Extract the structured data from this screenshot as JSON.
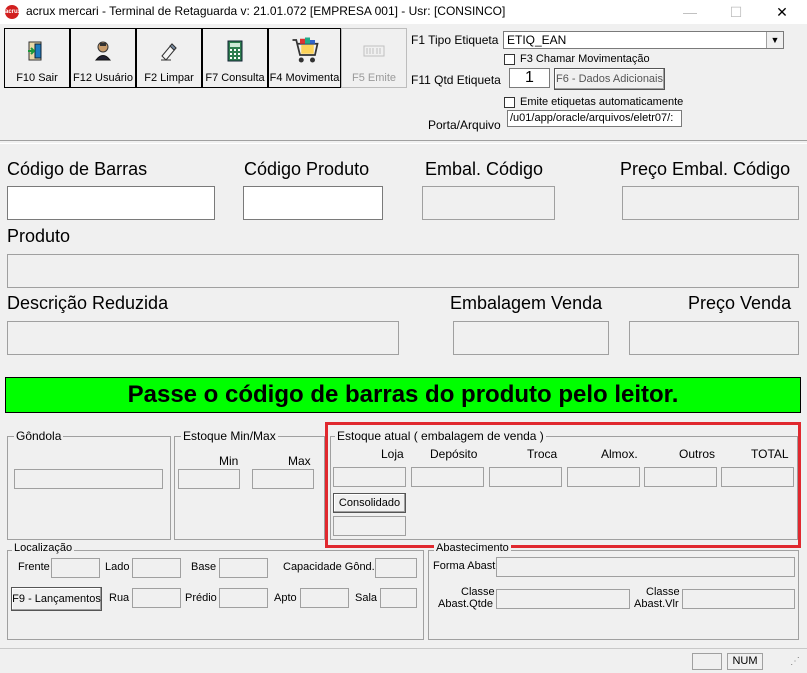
{
  "window": {
    "title": "acrux mercari - Terminal de Retaguarda v: 21.01.072 [EMPRESA 001] - Usr: [CONSINCO]",
    "icon_text": "acrux",
    "minimize": "—",
    "maximize": "☐",
    "close": "✕"
  },
  "toolbar": [
    {
      "label": "F10 Sair",
      "icon": "exit-door-icon",
      "enabled": true
    },
    {
      "label": "F12 Usuário",
      "icon": "user-icon",
      "enabled": true
    },
    {
      "label": "F2 Limpar",
      "icon": "eraser-icon",
      "enabled": true
    },
    {
      "label": "F7 Consulta",
      "icon": "calculator-icon",
      "enabled": true
    },
    {
      "label": "F4 Movimenta",
      "icon": "shopping-cart-icon",
      "enabled": true
    },
    {
      "label": "F5 Emite",
      "icon": "barcode-label-icon",
      "enabled": false
    }
  ],
  "settings": {
    "tipo_etiqueta_label": "F1 Tipo Etiqueta",
    "tipo_etiqueta_value": "ETIQ_EAN",
    "chamar_mov_label": "F3 Chamar Movimentação",
    "qtd_etiqueta_label": "F11 Qtd Etiqueta",
    "qtd_etiqueta_value": "1",
    "dados_adicionais_label": "F6 - Dados Adicionais",
    "emite_auto_label": "Emite etiquetas automaticamente",
    "porta_label": "Porta/Arquivo",
    "porta_value": "/u01/app/oracle/arquivos/eletr07/:"
  },
  "product": {
    "codigo_barras_label": "Código de Barras",
    "codigo_barras_value": "",
    "codigo_produto_label": "Código Produto",
    "codigo_produto_value": "",
    "embal_codigo_label": "Embal. Código",
    "preco_embal_codigo_label": "Preço Embal. Código",
    "produto_label": "Produto",
    "descricao_reduzida_label": "Descrição Reduzida",
    "embalagem_venda_label": "Embalagem Venda",
    "preco_venda_label": "Preço Venda"
  },
  "banner": {
    "message": "Passe o código de barras do produto pelo leitor.",
    "color": "#00ff00"
  },
  "gondola": {
    "title": "Gôndola"
  },
  "estoque_min_max": {
    "title": "Estoque Min/Max",
    "min": "Min",
    "max": "Max"
  },
  "estoque_atual": {
    "title": "Estoque atual ( embalagem de venda )",
    "columns": [
      "Loja",
      "Depósito",
      "Troca",
      "Almox.",
      "Outros",
      "TOTAL"
    ],
    "consolidado_label": "Consolidado",
    "highlight_color": "#e0282e"
  },
  "localizacao": {
    "title": "Localização",
    "frente": "Frente",
    "lado": "Lado",
    "base": "Base",
    "capacidade": "Capacidade Gônd.",
    "lancamentos_label": "F9 - Lançamentos",
    "rua": "Rua",
    "predio": "Prédio",
    "apto": "Apto",
    "sala": "Sala"
  },
  "abastecimento": {
    "title": "Abastecimento",
    "forma_abast": "Forma Abast",
    "classe_qtde_1": "Classe",
    "classe_qtde_2": "Abast.Qtde",
    "classe_vlr_1": "Classe",
    "classe_vlr_2": "Abast.Vlr"
  },
  "status": {
    "num": "NUM"
  }
}
